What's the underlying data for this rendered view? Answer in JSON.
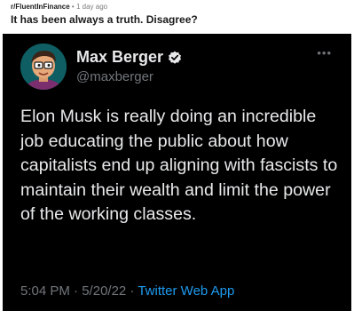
{
  "post": {
    "subreddit": "r/FluentInFinance",
    "separator": "•",
    "age": "1 day ago",
    "title": "It has been always a truth. Disagree?"
  },
  "tweet": {
    "display_name": "Max Berger",
    "handle": "@maxberger",
    "verified_icon": "verified-badge-icon",
    "more_icon": "ellipsis-icon",
    "text": "Elon Musk is really doing an incredible job educating the public about how capitalists end up aligning with fascists to maintain their wealth and limit the power of the working classes.",
    "time": "5:04 PM",
    "date": "5/20/22",
    "dot": "·",
    "source": "Twitter Web App"
  },
  "colors": {
    "tweet_background": "#000000",
    "text_primary": "#e7e9ea",
    "text_secondary": "#71767b",
    "link_blue": "#1d9bf0",
    "avatar_background": "#0e5e63"
  }
}
